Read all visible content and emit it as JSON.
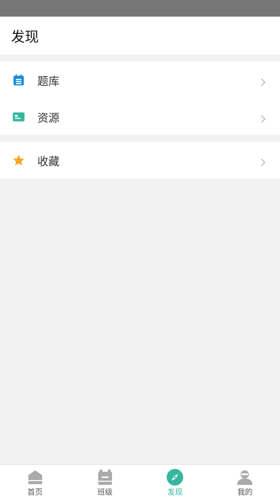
{
  "header": {
    "title": "发现"
  },
  "menu": {
    "items": [
      {
        "label": "题库",
        "icon": "question-bank-icon",
        "color": "#1a8cde"
      },
      {
        "label": "资源",
        "icon": "resources-icon",
        "color": "#36b79c"
      },
      {
        "label": "收藏",
        "icon": "star-icon",
        "color": "#f5a623"
      }
    ]
  },
  "tabbar": {
    "tabs": [
      {
        "label": "首页",
        "icon": "home-icon",
        "active": false
      },
      {
        "label": "班级",
        "icon": "class-icon",
        "active": false
      },
      {
        "label": "发现",
        "icon": "compass-icon",
        "active": true
      },
      {
        "label": "我的",
        "icon": "profile-icon",
        "active": false
      }
    ]
  },
  "colors": {
    "accent": "#36b79c",
    "inactive_icon": "#aaaaaa",
    "status_bar": "#777777"
  }
}
